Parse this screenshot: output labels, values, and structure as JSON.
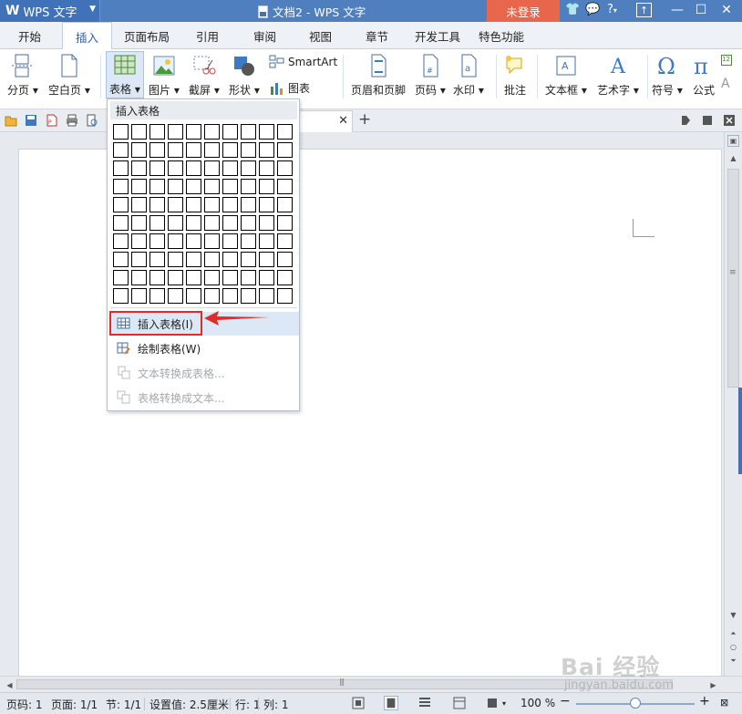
{
  "app": {
    "logo": "W",
    "name": "WPS 文字",
    "window_title": "文档2 - WPS 文字",
    "login_label": "未登录",
    "help_label": "?"
  },
  "tabs": [
    {
      "label": "开始"
    },
    {
      "label": "插入",
      "active": true
    },
    {
      "label": "页面布局"
    },
    {
      "label": "引用"
    },
    {
      "label": "审阅"
    },
    {
      "label": "视图"
    },
    {
      "label": "章节"
    },
    {
      "label": "开发工具"
    },
    {
      "label": "特色功能"
    }
  ],
  "ribbon": {
    "page_break": "分页",
    "blank_page": "空白页",
    "table": "表格",
    "picture": "图片",
    "screenshot": "截屏",
    "shape": "形状",
    "smartart": "SmartArt",
    "chart": "图表",
    "header_footer": "页眉和页脚",
    "page_number": "页码",
    "watermark": "水印",
    "comment": "批注",
    "text_box": "文本框",
    "word_art": "艺术字",
    "symbol": "符号",
    "formula": "公式"
  },
  "dropdown": {
    "header": "插入表格",
    "grid_rows": 10,
    "grid_cols": 10,
    "items": [
      {
        "label": "插入表格(I)",
        "enabled": true,
        "highlighted": true
      },
      {
        "label": "绘制表格(W)",
        "enabled": true
      },
      {
        "label": "文本转换成表格...",
        "enabled": false
      },
      {
        "label": "表格转换成文本...",
        "enabled": false
      }
    ]
  },
  "status": {
    "page_num": "页码: 1",
    "pages": "页面: 1/1",
    "section": "节: 1/1",
    "setting": "设置值: 2.5厘米",
    "row": "行: 1",
    "col": "列: 1",
    "zoom": "100 %"
  },
  "watermark": {
    "main": "Bai 经验",
    "sub": "jingyan.baidu.com"
  },
  "colors": {
    "titlebar": "#4f7fbf",
    "login": "#e8664c",
    "accent": "#2b5fb0",
    "arrow": "#e02b2b"
  }
}
